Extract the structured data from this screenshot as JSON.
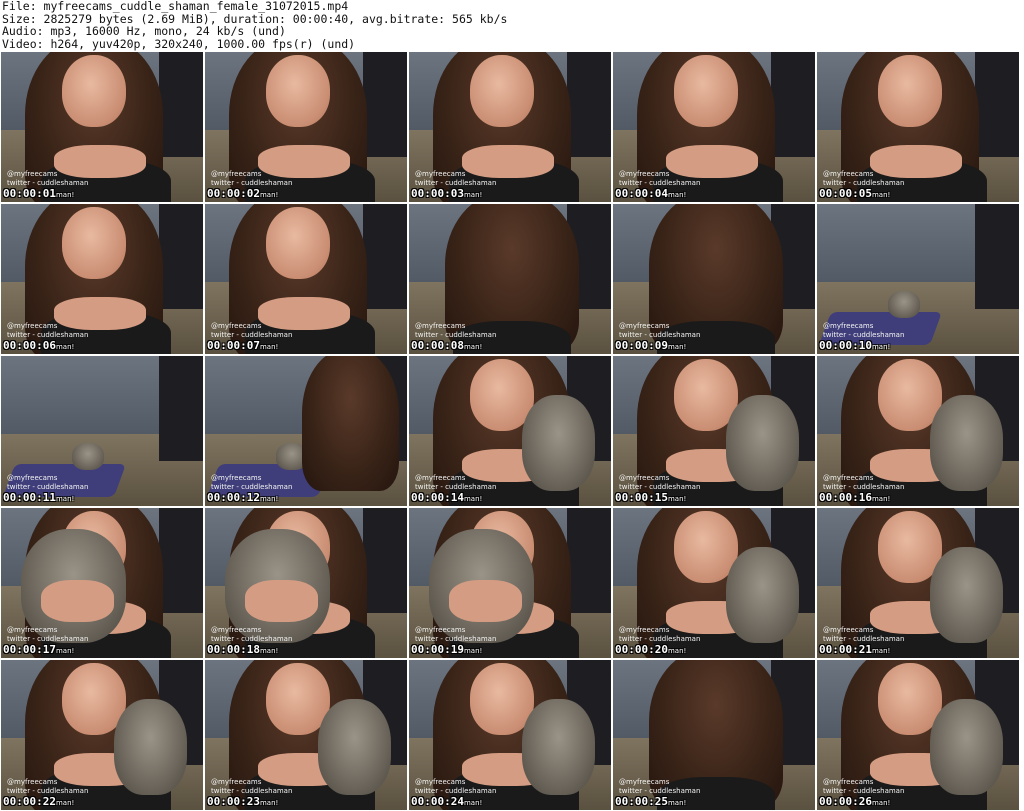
{
  "header": {
    "file_line": "File: myfreecams_cuddle_shaman_female_31072015.mp4",
    "size_line": "Size: 2825279 bytes (2.69 MiB), duration: 00:00:40, avg.bitrate: 565 kb/s",
    "audio_line": "Audio: mp3, 16000 Hz, mono, 24 kb/s (und)",
    "video_line": "Video: h264, yuv420p, 320x240, 1000.00 fps(r) (und)"
  },
  "watermark": {
    "line1": "@myfreecams",
    "line2": "twitter - cuddleshaman"
  },
  "thumbnails": [
    {
      "time": "00:00:01",
      "tail": "man!",
      "scene": "face"
    },
    {
      "time": "00:00:02",
      "tail": "man!",
      "scene": "face"
    },
    {
      "time": "00:00:03",
      "tail": "man!",
      "scene": "face"
    },
    {
      "time": "00:00:04",
      "tail": "man!",
      "scene": "face"
    },
    {
      "time": "00:00:05",
      "tail": "man!",
      "scene": "face"
    },
    {
      "time": "00:00:06",
      "tail": "man!",
      "scene": "face"
    },
    {
      "time": "00:00:07",
      "tail": "man!",
      "scene": "face"
    },
    {
      "time": "00:00:08",
      "tail": "man!",
      "scene": "hair"
    },
    {
      "time": "00:00:09",
      "tail": "man!",
      "scene": "hair"
    },
    {
      "time": "00:00:10",
      "tail": "man!",
      "scene": "room"
    },
    {
      "time": "00:00:11",
      "tail": "man!",
      "scene": "room"
    },
    {
      "time": "00:00:12",
      "tail": "man!",
      "scene": "roomhair"
    },
    {
      "time": "00:00:14",
      "tail": "man!",
      "scene": "facecat"
    },
    {
      "time": "00:00:15",
      "tail": "man!",
      "scene": "facecat"
    },
    {
      "time": "00:00:16",
      "tail": "man!",
      "scene": "facecat"
    },
    {
      "time": "00:00:17",
      "tail": "man!",
      "scene": "catclose"
    },
    {
      "time": "00:00:18",
      "tail": "man!",
      "scene": "catclose"
    },
    {
      "time": "00:00:19",
      "tail": "man!",
      "scene": "catclose"
    },
    {
      "time": "00:00:20",
      "tail": "man!",
      "scene": "facecat"
    },
    {
      "time": "00:00:21",
      "tail": "man!",
      "scene": "facecat"
    },
    {
      "time": "00:00:22",
      "tail": "man!",
      "scene": "facecat"
    },
    {
      "time": "00:00:23",
      "tail": "man!",
      "scene": "facecat"
    },
    {
      "time": "00:00:24",
      "tail": "man!",
      "scene": "facecat"
    },
    {
      "time": "00:00:25",
      "tail": "man!",
      "scene": "hair"
    },
    {
      "time": "00:00:26",
      "tail": "man!",
      "scene": "facecat"
    }
  ]
}
